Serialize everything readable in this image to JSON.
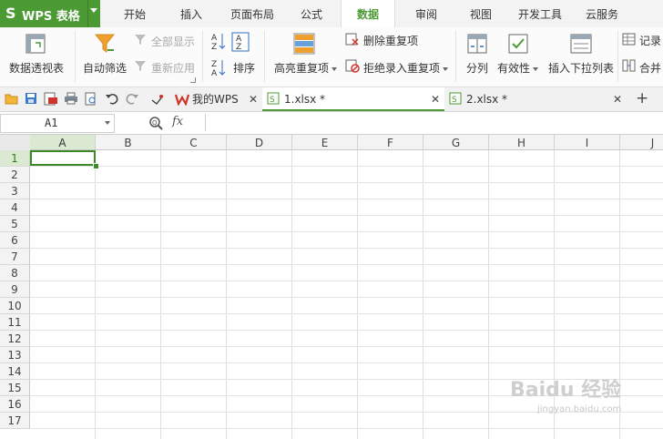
{
  "app": {
    "logo": "S",
    "name": "WPS 表格"
  },
  "menu": {
    "tabs": [
      "开始",
      "插入",
      "页面布局",
      "公式",
      "数据",
      "审阅",
      "视图",
      "开发工具",
      "云服务"
    ],
    "active": "数据"
  },
  "ribbon": {
    "pivot": "数据透视表",
    "autofilter": "自动筛选",
    "show_all": "全部显示",
    "reapply": "重新应用",
    "sort": "排序",
    "highlight_dup": "高亮重复项",
    "remove_dup": "删除重复项",
    "reject_dup": "拒绝录入重复项",
    "split": "分列",
    "validity": "有效性",
    "insert_dropdown": "插入下拉列表",
    "record": "记录",
    "merge": "合并"
  },
  "doc_tabs": [
    {
      "label": "我的WPS"
    },
    {
      "label": "1.xlsx *"
    },
    {
      "label": "2.xlsx *"
    }
  ],
  "formula_bar": {
    "name_box": "A1",
    "fx": "fx",
    "formula": ""
  },
  "sheet": {
    "columns": [
      "A",
      "B",
      "C",
      "D",
      "E",
      "F",
      "G",
      "H",
      "I",
      "J"
    ],
    "rows": [
      "1",
      "2",
      "3",
      "4",
      "5",
      "6",
      "7",
      "8",
      "9",
      "10",
      "11",
      "12",
      "13",
      "14",
      "15",
      "16",
      "17"
    ],
    "active_cell": "A1"
  },
  "watermark": {
    "text": "Baidu 经验",
    "sub": "jingyan.baidu.com"
  },
  "colors": {
    "accent": "#4b9a33",
    "active_cell_border": "#3b8a26"
  }
}
